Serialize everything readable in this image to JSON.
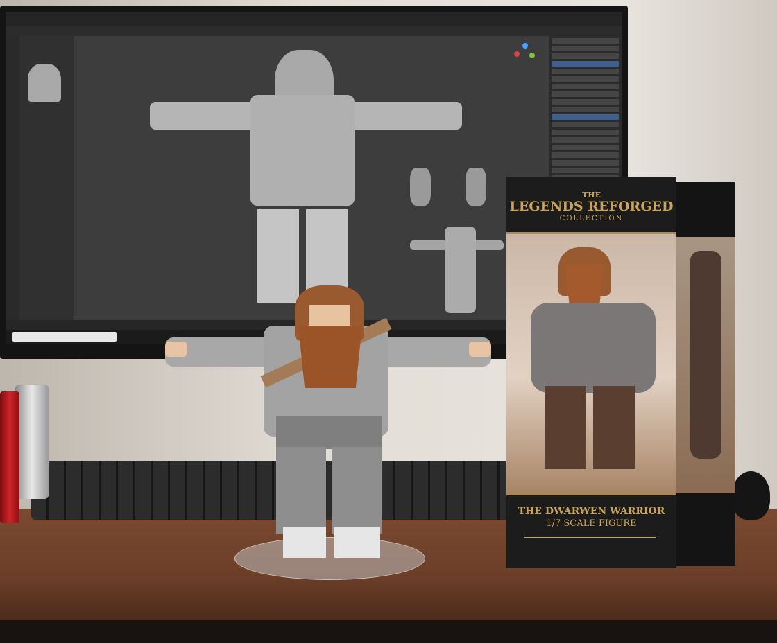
{
  "box": {
    "series_the": "THE",
    "series_name": "LEGENDS REFORGED",
    "series_collection": "COLLECTION",
    "figure_title": "THE DWARWEN WARRIOR",
    "figure_scale": "1/7 SCALE FIGURE",
    "accent_color": "#c9a45a"
  }
}
